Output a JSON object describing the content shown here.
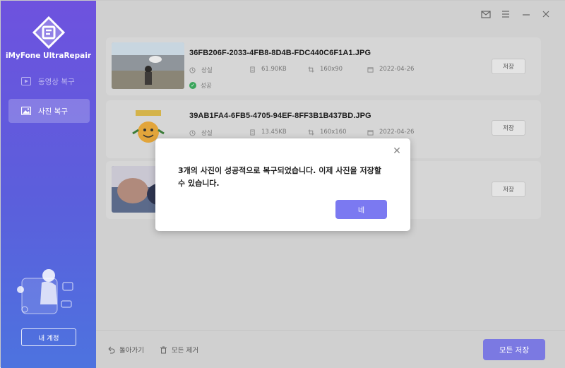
{
  "sidebar": {
    "app_name": "iMyFone UltraRepair",
    "items": [
      {
        "label": "동영상 복구",
        "icon": "video-icon"
      },
      {
        "label": "사진 복구",
        "icon": "photo-icon"
      }
    ],
    "account_label": "내 계정"
  },
  "files": [
    {
      "name": "36FB206F-2033-4FB8-8D4B-FDC440C6F1A1.JPG",
      "damage": "상실",
      "size": "61.90KB",
      "dimensions": "160x90",
      "date": "2022-04-26",
      "status": "성공",
      "save_label": "저장"
    },
    {
      "name": "39AB1FA4-6FB5-4705-94EF-8FF3B1B437BD.JPG",
      "damage": "상실",
      "size": "13.45KB",
      "dimensions": "160x160",
      "date": "2022-04-26",
      "save_label": "저장"
    },
    {
      "save_label": "저장"
    }
  ],
  "footer": {
    "back_label": "돌아가기",
    "clear_label": "모든 제거",
    "save_all_label": "모든 저장"
  },
  "dialog": {
    "message": "3개의 사진이 성공적으로 복구되었습니다. 이제 사진을 저장할 수 있습니다.",
    "ok_label": "네"
  },
  "colors": {
    "accent": "#7b79f1",
    "sidebar_top": "#6e52de",
    "sidebar_bottom": "#4d73df",
    "success": "#3aa55b"
  }
}
